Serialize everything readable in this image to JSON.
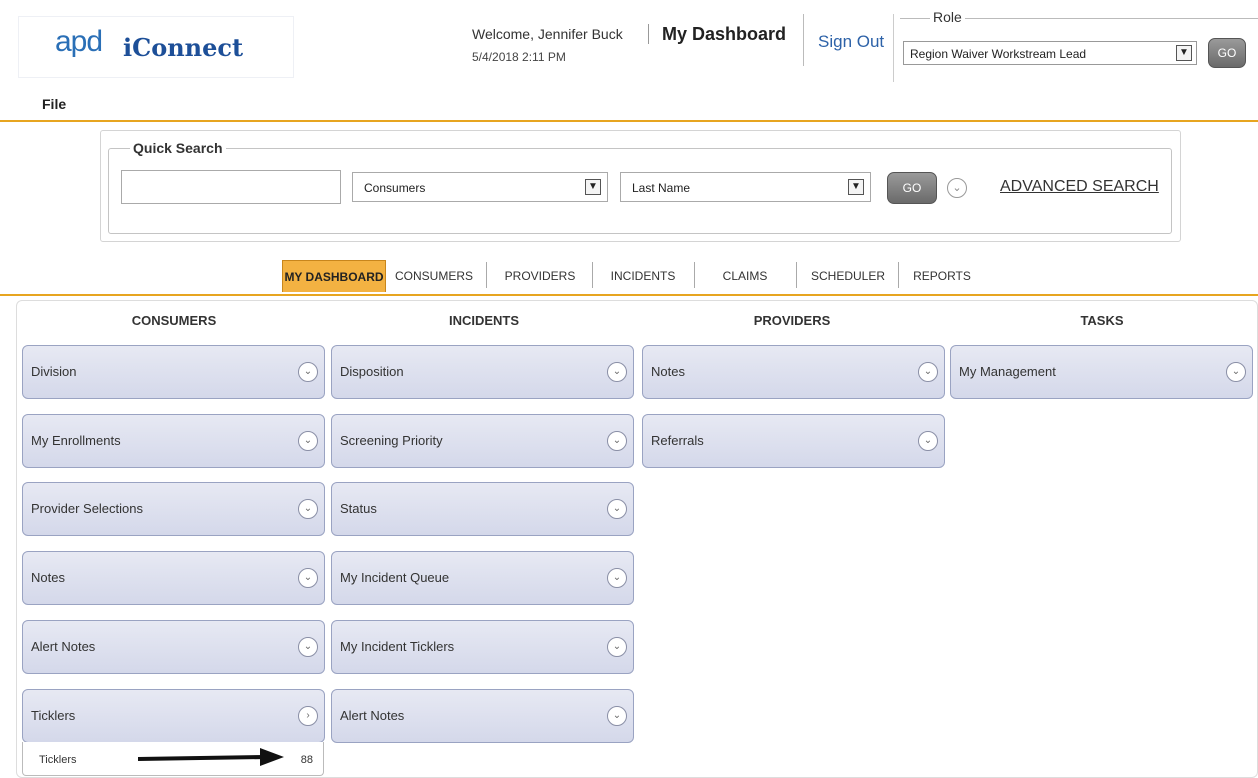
{
  "header": {
    "logo_apd": "apd",
    "logo_iconnect": "iConnect",
    "welcome": "Welcome, Jennifer Buck",
    "datetime": "5/4/2018 2:11 PM",
    "page_title": "My Dashboard",
    "sign_out": "Sign Out",
    "role_legend": "Role",
    "role_value": "Region Waiver Workstream Lead",
    "role_go": "GO"
  },
  "menu": {
    "file": "File"
  },
  "quick_search": {
    "legend": "Quick Search",
    "input_value": "",
    "type_value": "Consumers",
    "field_value": "Last Name",
    "go": "GO",
    "advanced": "ADVANCED SEARCH"
  },
  "tabs": [
    {
      "label": "MY DASHBOARD",
      "active": true
    },
    {
      "label": "CONSUMERS"
    },
    {
      "label": "PROVIDERS"
    },
    {
      "label": "INCIDENTS"
    },
    {
      "label": "CLAIMS"
    },
    {
      "label": "SCHEDULER"
    },
    {
      "label": "REPORTS"
    }
  ],
  "columns": {
    "consumers": {
      "title": "CONSUMERS",
      "items": [
        "Division",
        "My Enrollments",
        "Provider Selections",
        "Notes",
        "Alert Notes",
        "Ticklers"
      ]
    },
    "incidents": {
      "title": "INCIDENTS",
      "items": [
        "Disposition",
        "Screening Priority",
        "Status",
        "My Incident Queue",
        "My Incident Ticklers",
        "Alert Notes"
      ]
    },
    "providers": {
      "title": "PROVIDERS",
      "items": [
        "Notes",
        "Referrals"
      ]
    },
    "tasks": {
      "title": "TASKS",
      "items": [
        "My Management"
      ]
    }
  },
  "ticklers_expanded": {
    "label": "Ticklers",
    "count": "88"
  },
  "colors": {
    "accent": "#e7a520",
    "tab_active": "#f3b242",
    "widget": "#d4d8ea",
    "link": "#2d62a8"
  }
}
